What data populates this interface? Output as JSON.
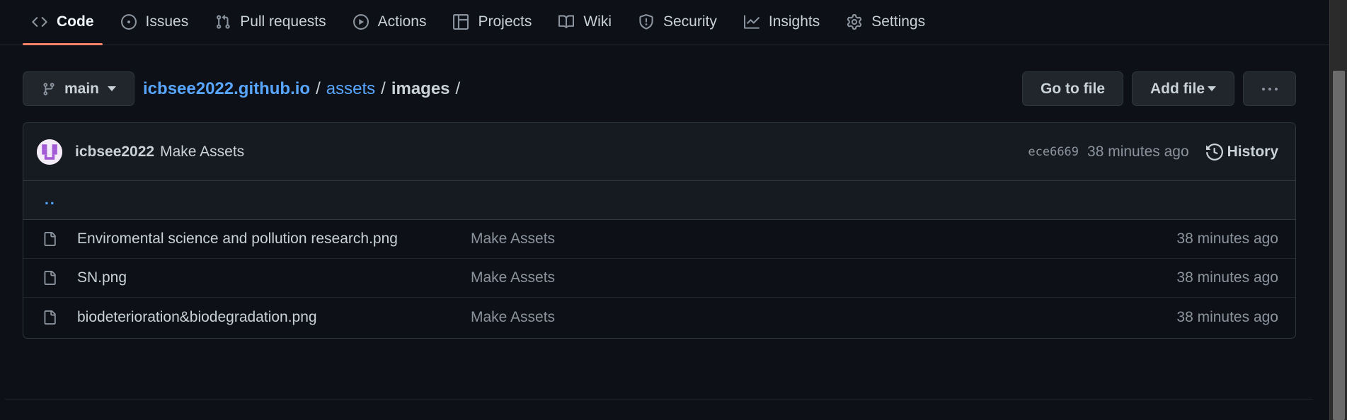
{
  "repo_nav": {
    "tabs": [
      {
        "label": "Code",
        "icon": "code-icon",
        "active": true
      },
      {
        "label": "Issues",
        "icon": "issue-icon",
        "active": false
      },
      {
        "label": "Pull requests",
        "icon": "pull-request-icon",
        "active": false
      },
      {
        "label": "Actions",
        "icon": "play-icon",
        "active": false
      },
      {
        "label": "Projects",
        "icon": "table-icon",
        "active": false
      },
      {
        "label": "Wiki",
        "icon": "book-icon",
        "active": false
      },
      {
        "label": "Security",
        "icon": "shield-icon",
        "active": false
      },
      {
        "label": "Insights",
        "icon": "graph-icon",
        "active": false
      },
      {
        "label": "Settings",
        "icon": "gear-icon",
        "active": false
      }
    ]
  },
  "toolbar": {
    "branch": "main",
    "breadcrumb": {
      "root": "icbsee2022.github.io",
      "folder": "assets",
      "current": "images",
      "separator": "/"
    },
    "go_to_file": "Go to file",
    "add_file": "Add file"
  },
  "commit": {
    "author": "icbsee2022",
    "message": "Make Assets",
    "sha": "ece6669",
    "time": "38 minutes ago",
    "history_label": "History"
  },
  "parent_link": "..",
  "files": [
    {
      "name": "Enviromental science and pollution research.png",
      "message": "Make Assets",
      "time": "38 minutes ago"
    },
    {
      "name": "SN.png",
      "message": "Make Assets",
      "time": "38 minutes ago"
    },
    {
      "name": "biodeterioration&biodegradation.png",
      "message": "Make Assets",
      "time": "38 minutes ago"
    }
  ],
  "colors": {
    "background": "#0d1117",
    "accent_link": "#58a6ff",
    "active_tab_underline": "#f78166"
  }
}
